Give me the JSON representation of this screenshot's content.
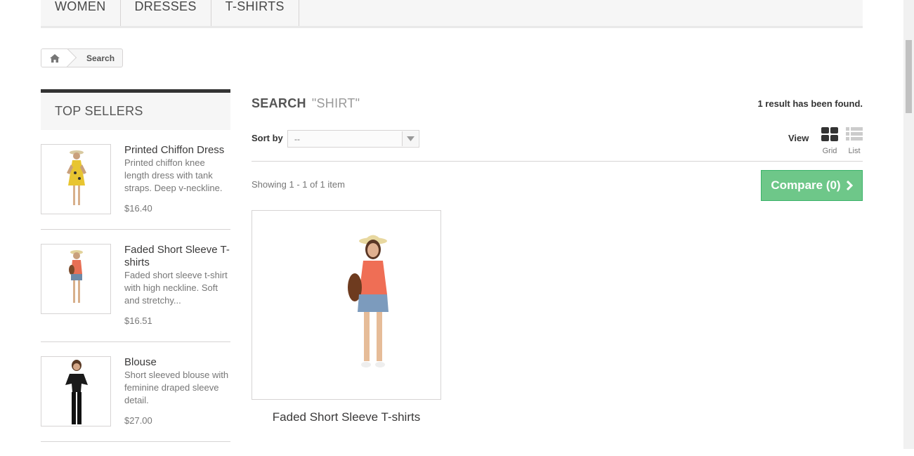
{
  "menu": {
    "items": [
      {
        "label": "Women"
      },
      {
        "label": "Dresses"
      },
      {
        "label": "T-shirts"
      }
    ]
  },
  "breadcrumb": {
    "home_icon": "home-icon",
    "current": "Search"
  },
  "top_sellers": {
    "title": "Top sellers",
    "items": [
      {
        "name": "Printed Chiffon Dress",
        "description": "Printed chiffon knee length dress with tank straps. Deep v-neckline.",
        "price": "$16.40"
      },
      {
        "name": "Faded Short Sleeve T-shirts",
        "description": "Faded short sleeve t-shirt with high neckline. Soft and stretchy...",
        "price": "$16.51"
      },
      {
        "name": "Blouse",
        "description": "Short sleeved blouse with feminine draped sleeve detail.",
        "price": "$27.00"
      }
    ]
  },
  "main": {
    "heading": "Search",
    "search_term": "\"shirt\"",
    "result_count": "1 result has been found.",
    "sort_label": "Sort by",
    "sort_value": "--",
    "view_label": "View",
    "view_grid": "Grid",
    "view_list": "List",
    "showing": "Showing 1 - 1 of 1 item",
    "compare_label": "Compare (0)",
    "products": [
      {
        "name": "Faded Short Sleeve T-shirts"
      }
    ]
  },
  "colors": {
    "accent_green": "#6ec789",
    "heading_bar": "#333333"
  }
}
